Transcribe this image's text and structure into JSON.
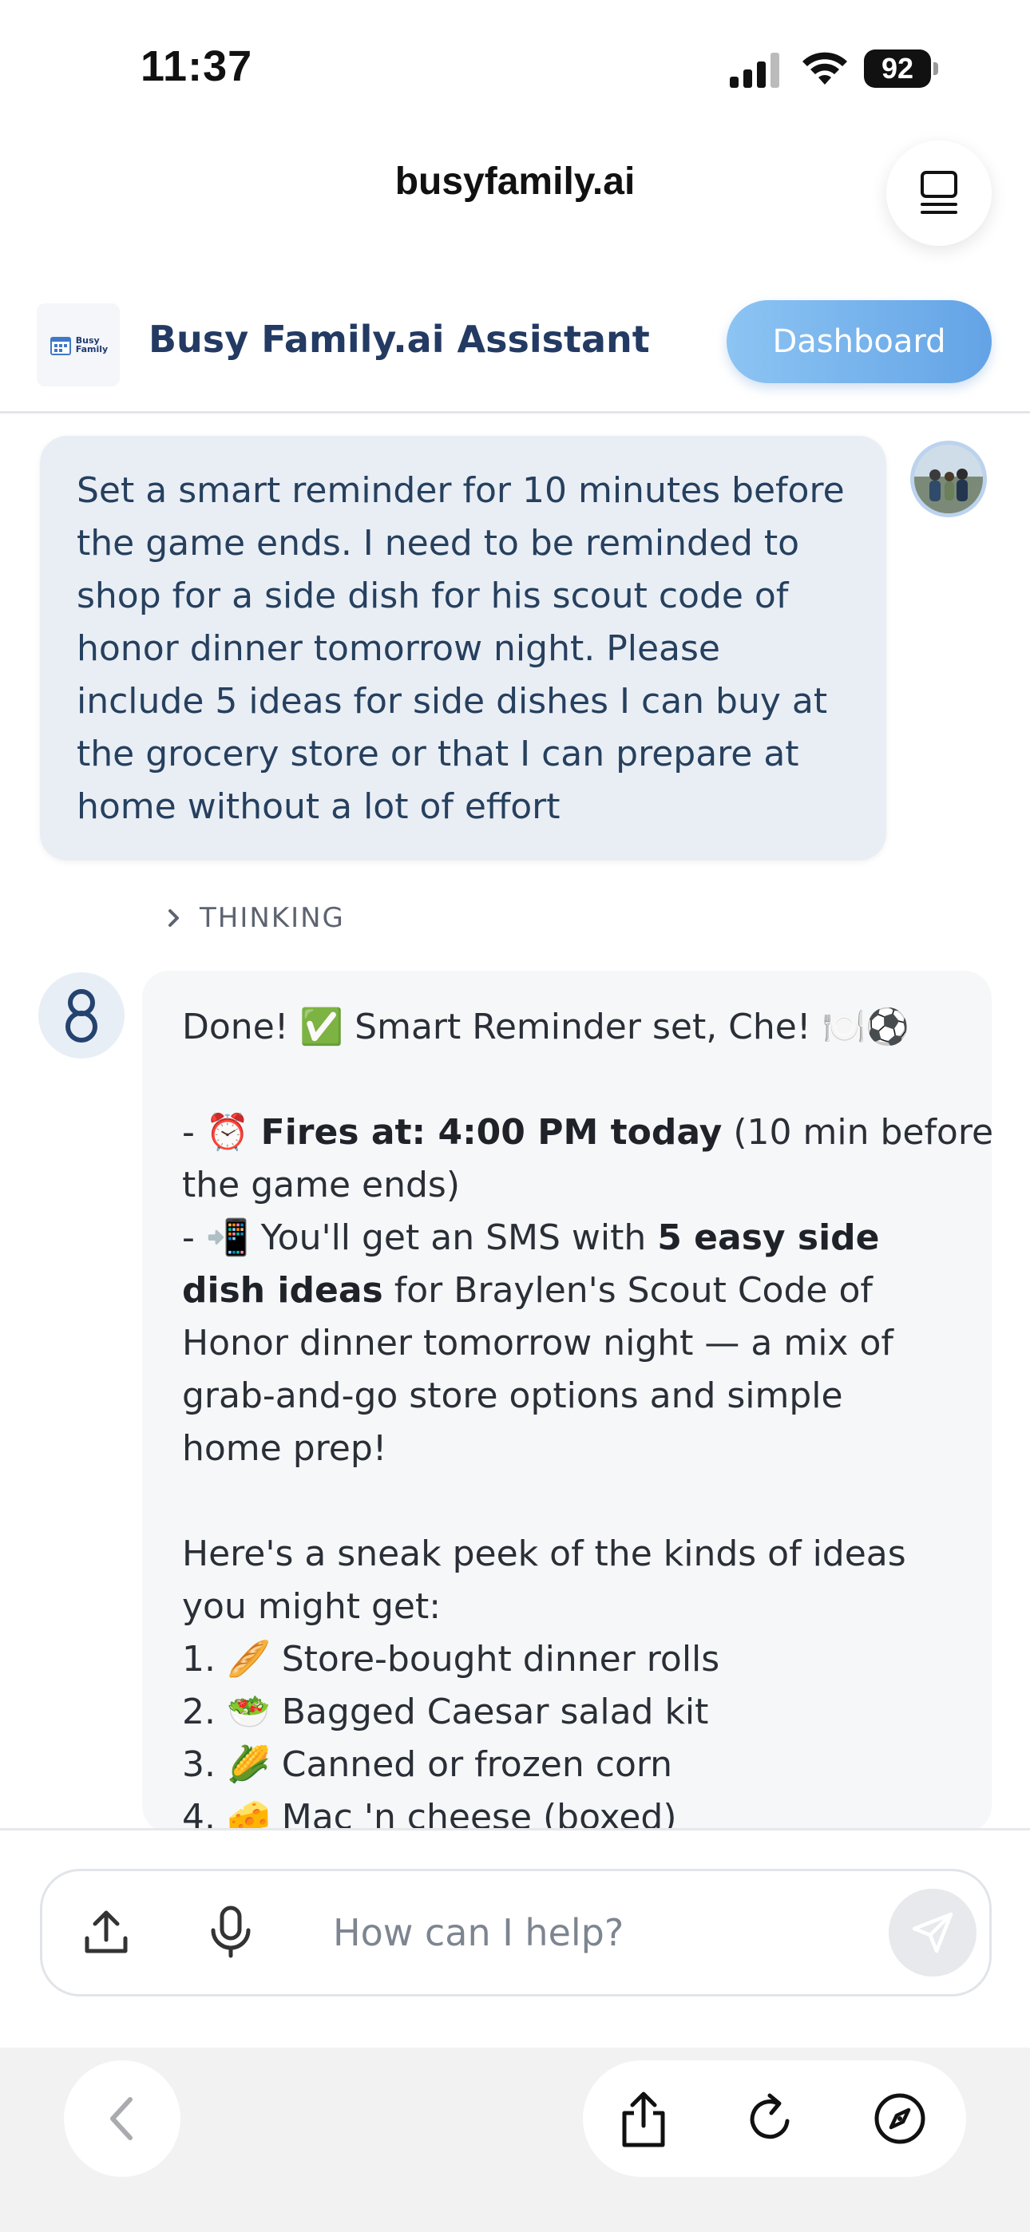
{
  "status_bar": {
    "time": "11:37",
    "battery": "92"
  },
  "browser": {
    "url_title": "busyfamily.ai"
  },
  "header": {
    "logo_text_line1": "Busy",
    "logo_text_line2": "Family",
    "title": "Busy Family.ai Assistant",
    "dashboard_label": "Dashboard"
  },
  "user_message": {
    "text": "Set a smart reminder for 10 minutes before\nthe game ends. I need to be reminded to\nshop for a side dish for his scout code of\nhonor dinner tomorrow night. Please\ninclude 5 ideas for side dishes I can buy at\nthe grocery store or that I can prepare at\nhome without a lot of effort"
  },
  "thinking": {
    "label": "THINKING"
  },
  "assistant_message": {
    "l1": "Done! ✅ Smart Reminder set, Che! 🍽️⚽",
    "l3_prefix": "- ⏰ ",
    "l3_bold": "Fires at: 4:00 PM today",
    "l3_rest": " (10 min before",
    "l4": "the game ends)",
    "l5_prefix": "- 📲 You'll get an SMS with ",
    "l5_bold": "5 easy side",
    "l6_bold": "dish ideas",
    "l6_rest": " for Braylen's Scout Code of",
    "l7": "Honor dinner tomorrow night — a mix of",
    "l8": "grab-and-go store options and simple",
    "l9": "home prep!",
    "l11": "Here's a sneak peek of the kinds of ideas",
    "l12": "you might get:",
    "ideas": [
      "1. 🥖 Store-bought dinner rolls",
      "2. 🥗 Bagged Caesar salad kit",
      "3. 🌽 Canned or frozen corn",
      "4. 🧀 Mac 'n cheese (boxed)"
    ]
  },
  "input": {
    "placeholder": "How can I help?"
  },
  "icons": {
    "signal": "cellular-signal-icon",
    "wifi": "wifi-icon",
    "tabs": "tabs-icon",
    "upload": "upload-icon",
    "mic": "microphone-icon",
    "send": "send-icon",
    "back": "chevron-left-icon",
    "share": "share-icon",
    "reload": "reload-icon",
    "compass": "compass-icon"
  }
}
